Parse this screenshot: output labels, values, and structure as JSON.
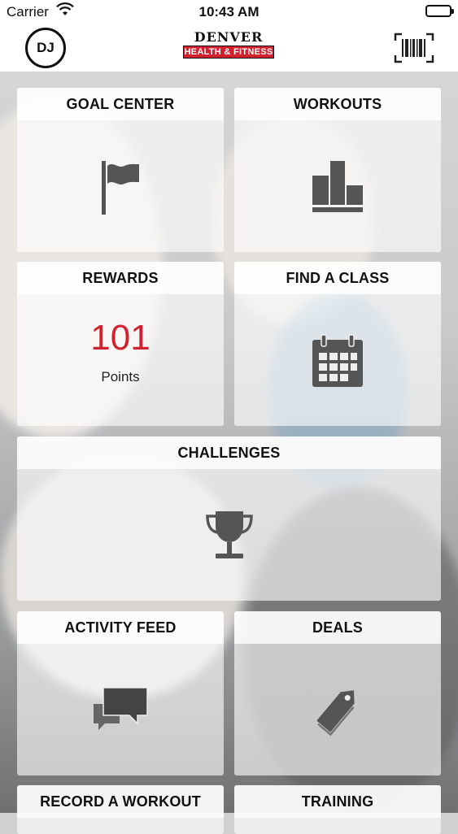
{
  "status_bar": {
    "carrier": "Carrier",
    "time": "10:43 AM"
  },
  "header": {
    "avatar_initials": "DJ",
    "logo_line1": "DENVER",
    "logo_line2": "HEALTH & FITNESS",
    "barcode_icon": "barcode-icon"
  },
  "tiles": {
    "goal_center": {
      "title": "GOAL CENTER",
      "icon": "flag-icon"
    },
    "workouts": {
      "title": "WORKOUTS",
      "icon": "bar-chart-icon"
    },
    "rewards": {
      "title": "REWARDS",
      "points": "101",
      "points_label": "Points"
    },
    "find_a_class": {
      "title": "FIND A CLASS",
      "icon": "calendar-icon"
    },
    "challenges": {
      "title": "CHALLENGES",
      "icon": "trophy-icon"
    },
    "activity_feed": {
      "title": "ACTIVITY FEED",
      "icon": "chat-bubbles-icon"
    },
    "deals": {
      "title": "DEALS",
      "icon": "tag-icon"
    },
    "record_a_workout": {
      "title": "RECORD A WORKOUT"
    },
    "training": {
      "title": "TRAINING"
    }
  },
  "colors": {
    "accent_red": "#d3202f",
    "icon_gray": "#555555"
  }
}
